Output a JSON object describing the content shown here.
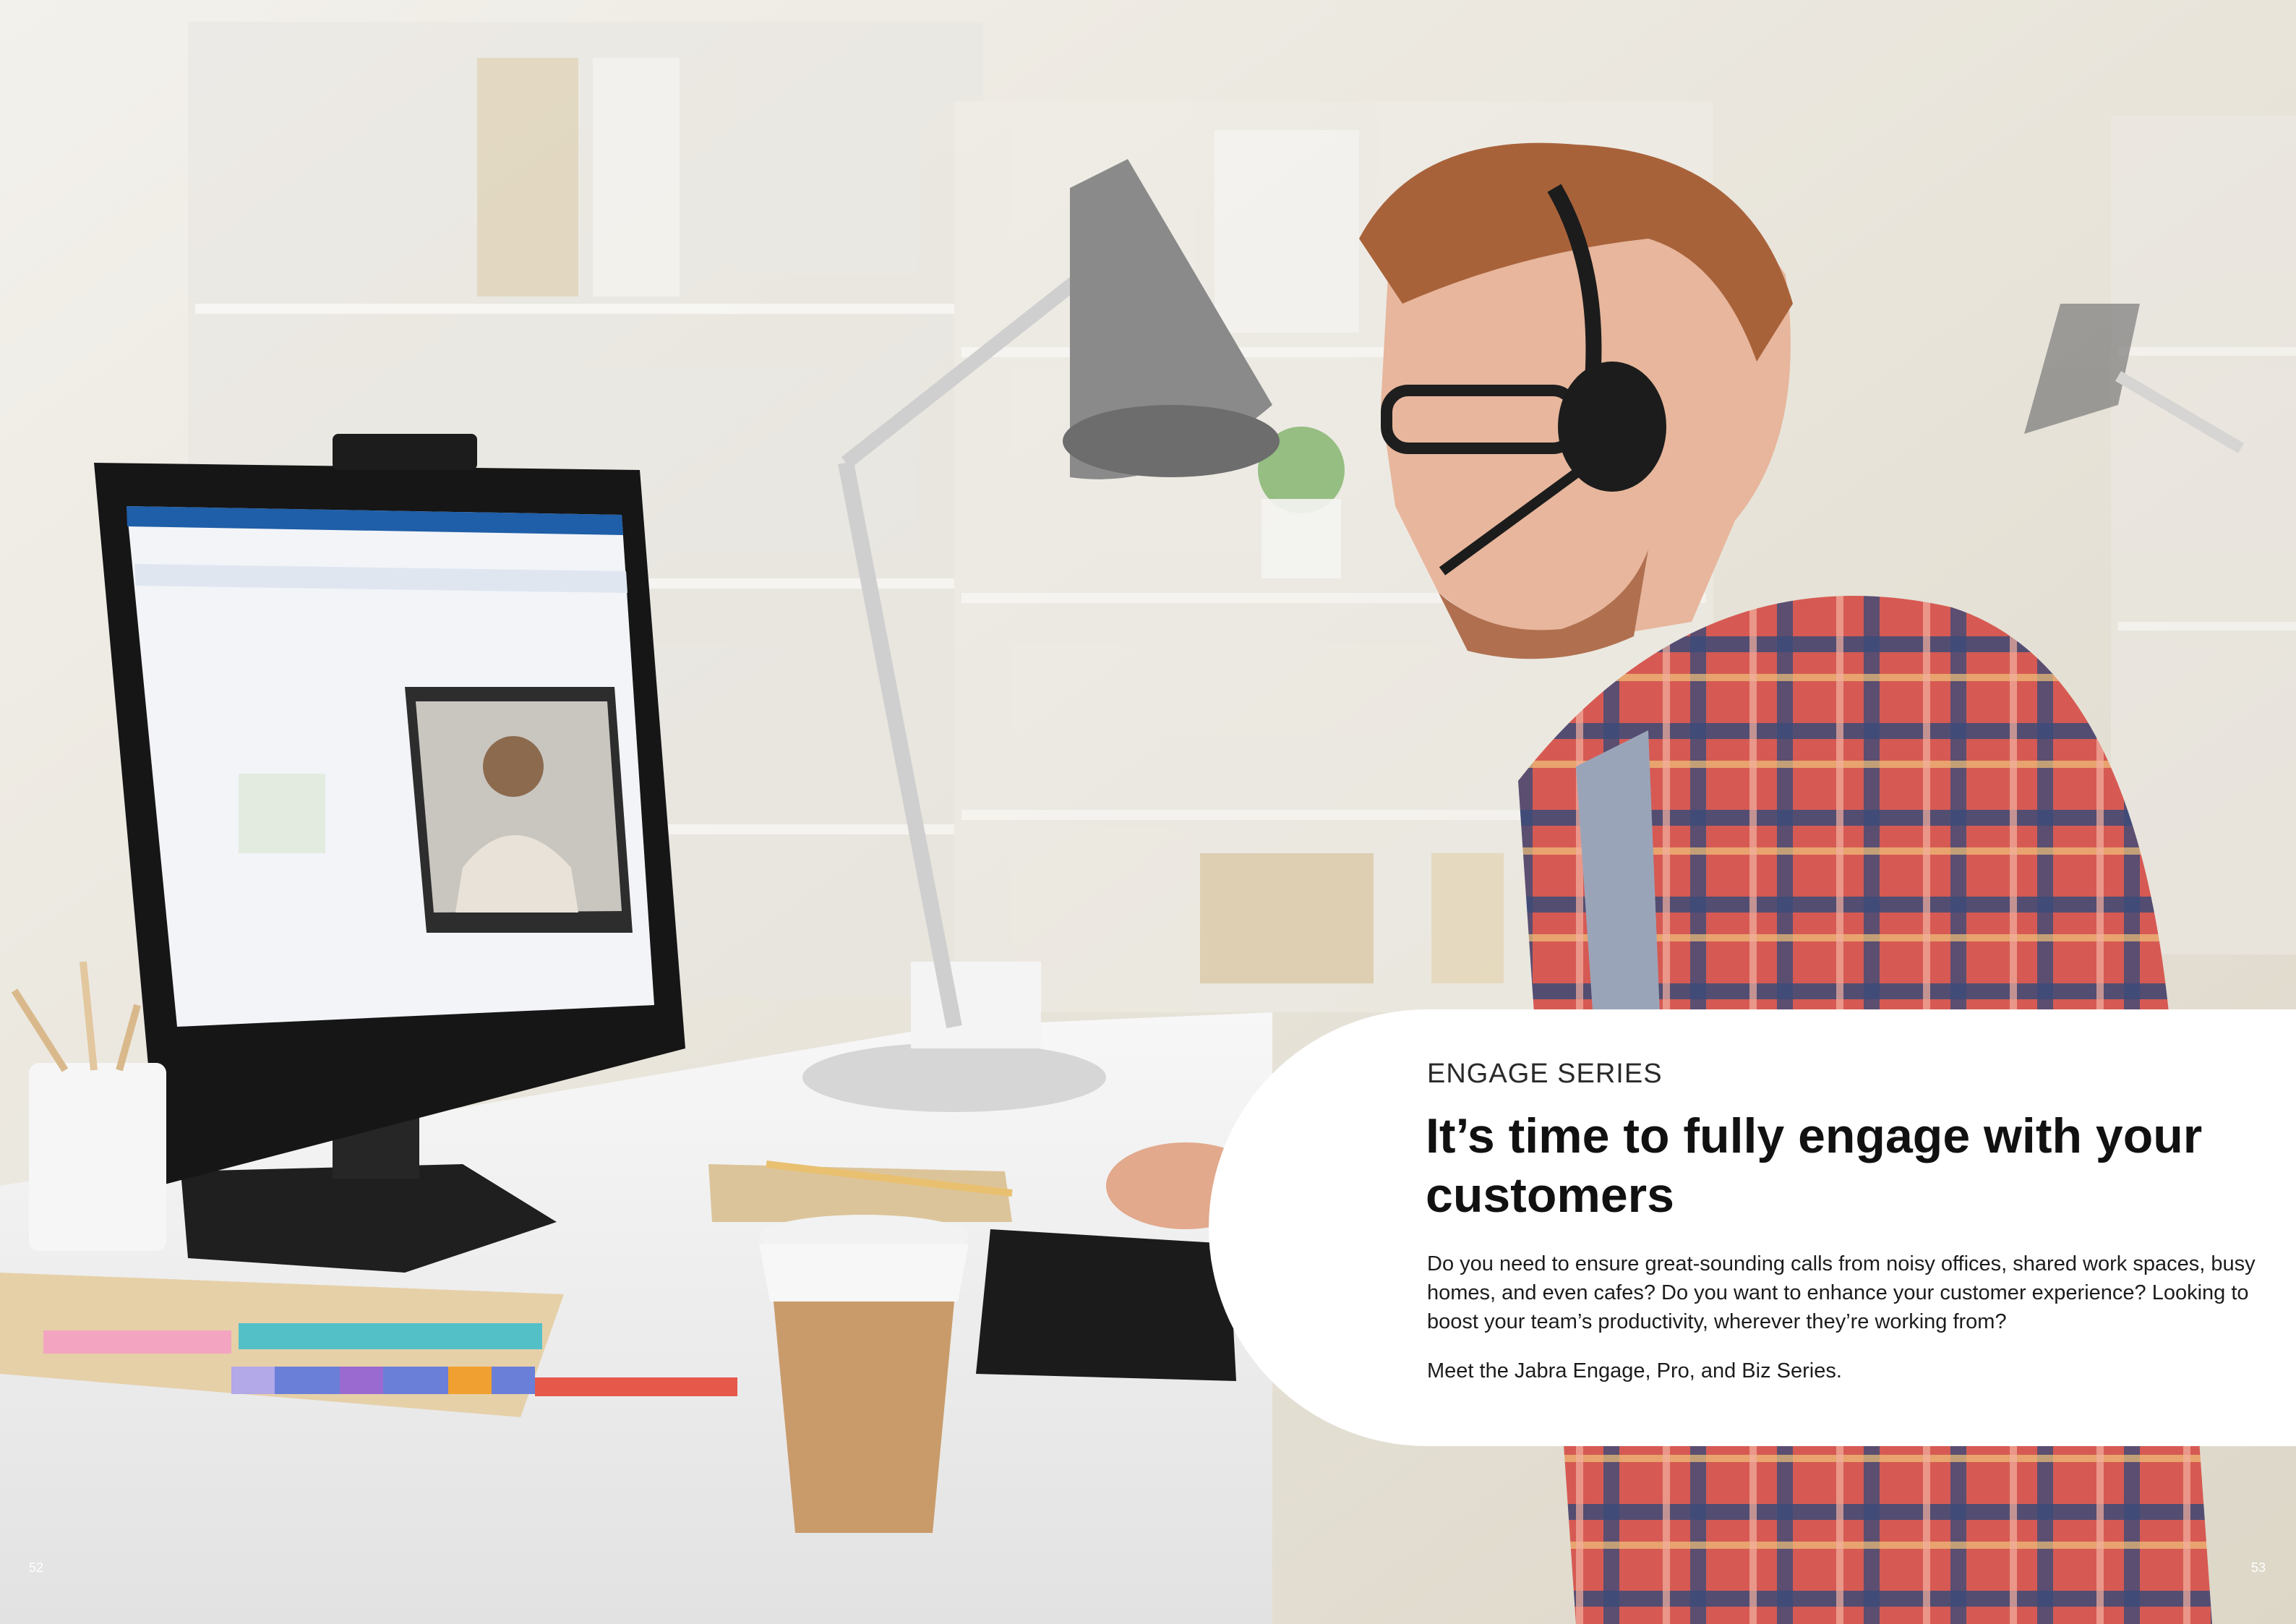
{
  "card": {
    "eyebrow": "ENGAGE SERIES",
    "headline": "It’s time to fully engage with your customers",
    "body": "Do you need to ensure great-sounding calls from noisy offices, shared work spaces, busy homes, and even cafes? Do you want to enhance your customer experience? Looking to boost your team’s productivity, wherever they’re working from?",
    "closing": "Meet the Jabra Engage, Pro, and Biz Series."
  },
  "page_numbers": {
    "left": "52",
    "right": "53"
  },
  "colors": {
    "panel": "#ffffff",
    "text": "#111111",
    "shirt_red": "#d9544f",
    "shirt_navy": "#3d4c7a"
  }
}
